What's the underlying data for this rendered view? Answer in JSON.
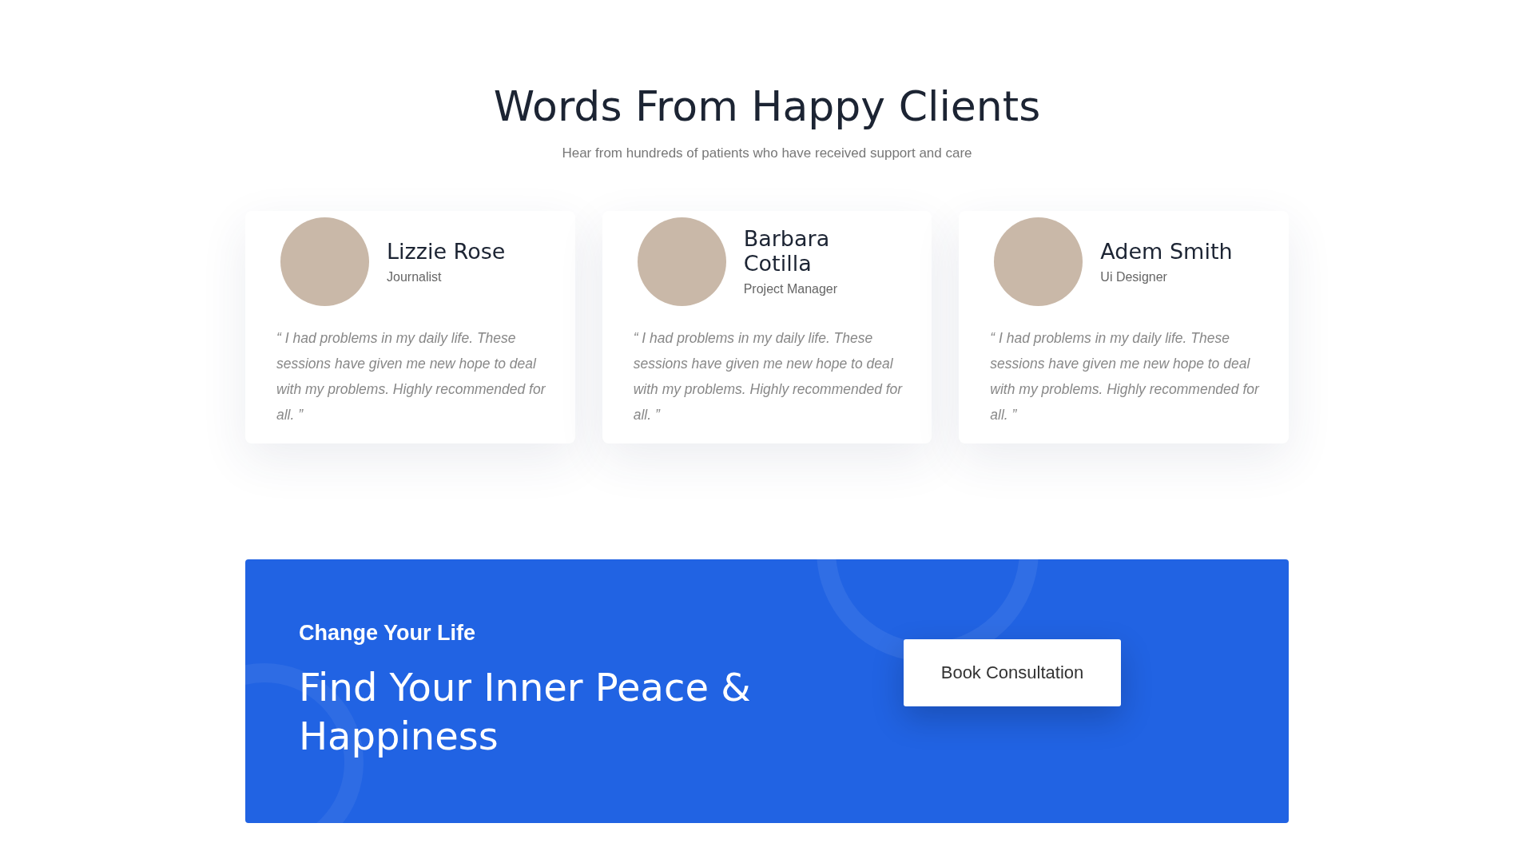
{
  "header": {
    "title": "Words From Happy Clients",
    "subtitle": "Hear from hundreds of patients who have received support and care"
  },
  "testimonials": [
    {
      "name": "Lizzie Rose",
      "role": "Journalist",
      "quote": "“ I had problems in my daily life. These sessions have given me new hope to deal with my problems. Highly recommended for all. ”"
    },
    {
      "name": "Barbara Cotilla",
      "role": "Project Manager",
      "quote": "“ I had problems in my daily life. These sessions have given me new hope to deal with my problems. Highly recommended for all. ”"
    },
    {
      "name": "Adem Smith",
      "role": "Ui Designer",
      "quote": "“ I had problems in my daily life. These sessions have given me new hope to deal with my problems. Highly recommended for all. ”"
    }
  ],
  "cta": {
    "eyebrow": "Change Your Life",
    "headline": "Find Your Inner Peace & Happiness",
    "button": "Book Consultation"
  }
}
